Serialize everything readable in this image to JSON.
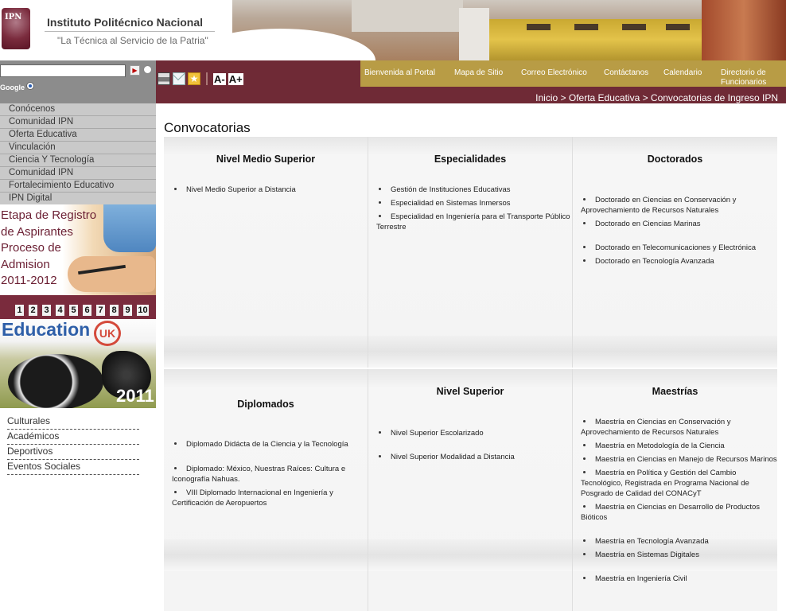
{
  "header": {
    "logo_text": "IPN",
    "institution": "Instituto Politécnico Nacional",
    "tagline": "\"La Técnica al Servicio de la Patria\""
  },
  "search": {
    "value": "",
    "go_label": "▶",
    "google_label": "Google"
  },
  "sidebar": {
    "menu": [
      "Conócenos",
      "Comunidad IPN",
      "Oferta Educativa",
      "Vinculación",
      "Ciencia Y Tecnología",
      "Comunidad IPN",
      "Fortalecimiento Educativo",
      "IPN Digital"
    ],
    "banner_registro": "Etapa de Registro\nde Aspirantes\nProceso de\nAdmision\n2011-2012",
    "pager": [
      "1",
      "2",
      "3",
      "4",
      "5",
      "6",
      "7",
      "8",
      "9",
      "10"
    ],
    "banner_education": {
      "title": "Education",
      "badge": "UK",
      "year": "2011"
    },
    "links": [
      "Culturales",
      "Académicos",
      "Deportivos",
      "Eventos Sociales"
    ]
  },
  "toolbar": {
    "font_decrease": "A-",
    "font_increase": "A+",
    "fav_icon": "★"
  },
  "topnav": [
    "Bienvenida al Portal",
    "Mapa de Sitio",
    "Correo Electrónico",
    "Contáctanos",
    "Calendario",
    "Directorio de\nFuncionarios"
  ],
  "breadcrumb": "Inicio > Oferta Educativa > Convocatorias de Ingreso IPN",
  "main": {
    "title": "Convocatorias",
    "row1": [
      {
        "title": "Nivel Medio Superior",
        "items": [
          "Nivel Medio Superior a Distancia"
        ]
      },
      {
        "title": "Especialidades",
        "items": [
          "Gestión de Instituciones Educativas",
          "Especialidad en Sistemas Inmersos",
          "Especialidad en Ingeniería para el Transporte Público Terrestre"
        ]
      },
      {
        "title": "Doctorados",
        "items": [
          "Doctorado en Ciencias en Conservación y Aprovechamiento de Recursos Naturales",
          "Doctorado en Ciencias Marinas",
          "Doctorado en Telecomunicaciones y Electrónica",
          "Doctorado en Tecnología Avanzada"
        ]
      }
    ],
    "row2": [
      {
        "title": "Diplomados",
        "items": [
          "Diplomado Didácta de la Ciencia y la Tecnología",
          "Diplomado: México, Nuestras Raíces: Cultura e Iconografía Nahuas.",
          "VIII Diplomado Internacional en Ingeniería y Certificación de Aeropuertos"
        ]
      },
      {
        "title": "Nivel Superior",
        "items": [
          "Nivel Superior Escolarizado",
          "Nivel Superior Modalidad a Distancia"
        ]
      },
      {
        "title": "Maestrías",
        "items": [
          "Maestría  en Ciencias en Conservación y Aprovechamiento de Recursos Naturales",
          "Maestría en Metodología de la Ciencia",
          "Maestría en Ciencias en Manejo de Recursos Marinos",
          "Maestría en Política y Gestión del Cambio Tecnológico, Registrada en Programa Nacional de Posgrado de Calidad del CONACyT",
          "Maestría en Ciencias en Desarrollo de Productos Bióticos",
          "Maestría en Tecnología Avanzada",
          "Maestría en Sistemas Digitales",
          "Maestría en Ingeniería Civil"
        ]
      }
    ]
  },
  "colors": {
    "maroon": "#6f2a36",
    "gold": "#b89c45",
    "menu_gray": "#c9c9c9"
  }
}
